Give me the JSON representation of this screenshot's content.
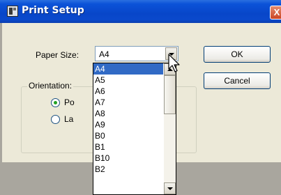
{
  "window": {
    "title": "Print Setup",
    "close_glyph": "X"
  },
  "paper_size": {
    "label": "Paper Size:",
    "selected": "A4",
    "options": [
      "A4",
      "A5",
      "A6",
      "A7",
      "A8",
      "A9",
      "B0",
      "B1",
      "B10",
      "B2"
    ]
  },
  "orientation": {
    "label": "Orientation:",
    "options": [
      {
        "label": "Po",
        "checked": true
      },
      {
        "label": "La",
        "checked": false
      }
    ]
  },
  "buttons": {
    "ok": "OK",
    "cancel": "Cancel"
  },
  "icons": [
    "printer-icon",
    "close-icon",
    "chevron-down-icon",
    "scroll-up-icon",
    "scroll-down-icon",
    "mouse-cursor-icon"
  ],
  "colors": {
    "titlebar": "#0b52d8",
    "selection": "#316ac5",
    "dialog": "#ece9d8",
    "backdrop": "#a9a69e"
  }
}
